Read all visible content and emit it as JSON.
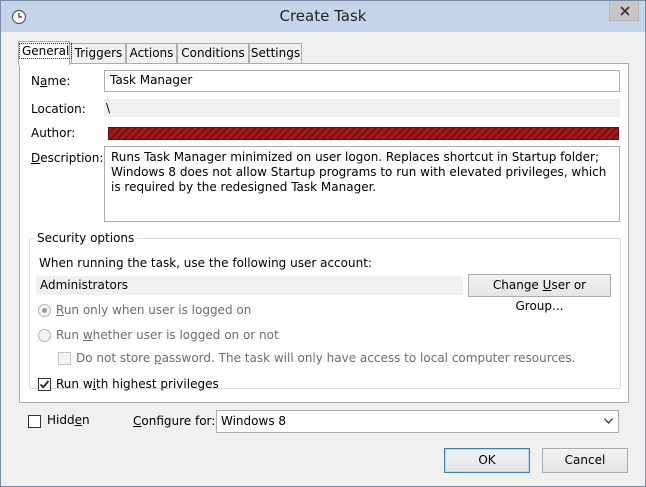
{
  "window": {
    "title": "Create Task"
  },
  "tabs": [
    {
      "label": "General"
    },
    {
      "label": "Triggers"
    },
    {
      "label": "Actions"
    },
    {
      "label": "Conditions"
    },
    {
      "label": "Settings"
    }
  ],
  "general": {
    "name_label_pre": "N",
    "name_label_ul": "a",
    "name_label_post": "me:",
    "name_value": "Task Manager",
    "location_label": "Location:",
    "location_value": "\\",
    "author_label": "Author:",
    "description_label_ul": "D",
    "description_label_post": "escription:",
    "description_value": "Runs Task Manager minimized on user logon.  Replaces shortcut in Startup folder; Windows 8 does not allow Startup programs to run with elevated privileges, which is required by the redesigned Task Manager."
  },
  "security": {
    "title": "Security options",
    "account_prompt": "When running the task, use the following user account:",
    "account_value": "Administrators",
    "change_user_pre": "Change ",
    "change_user_ul": "U",
    "change_user_post": "ser or Group...",
    "radio_logged_on_ul": "R",
    "radio_logged_on_post": "un only when user is logged on",
    "radio_whether_pre": "Run ",
    "radio_whether_ul": "w",
    "radio_whether_post": "hether user is logged on or not",
    "no_store_pre": "Do not store ",
    "no_store_ul": "p",
    "no_store_post": "assword.  The task will only have access to local computer resources.",
    "highest_pre": "Run w",
    "highest_ul": "i",
    "highest_post": "th highest privileges",
    "highest_checked": true,
    "logged_on_selected": true
  },
  "footer": {
    "hidden_pre": "Hidd",
    "hidden_ul": "e",
    "hidden_post": "n",
    "hidden_checked": false,
    "configure_ul": "C",
    "configure_post": "onfigure for:",
    "configure_value": "Windows 8",
    "ok_label": "OK",
    "cancel_label": "Cancel"
  },
  "colors": {
    "titlebar": "#c5d6ec",
    "redaction": "#a51a1a"
  }
}
